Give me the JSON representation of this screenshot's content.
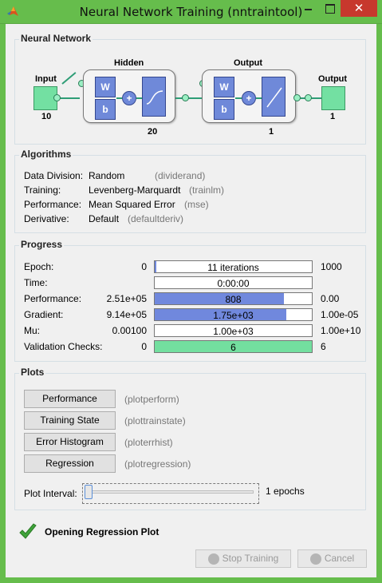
{
  "window": {
    "title": "Neural Network Training (nntraintool)",
    "close_glyph": "✕"
  },
  "network": {
    "section_title": "Neural Network",
    "input": {
      "label": "Input",
      "size": "10"
    },
    "hidden": {
      "label": "Hidden",
      "size": "20",
      "w_label": "W",
      "b_label": "b",
      "sum_label": "+"
    },
    "output_layer": {
      "label": "Output",
      "size": "1",
      "w_label": "W",
      "b_label": "b",
      "sum_label": "+"
    },
    "output": {
      "label": "Output",
      "size": "1"
    }
  },
  "algorithms": {
    "section_title": "Algorithms",
    "rows": [
      {
        "label": "Data Division:",
        "value": "Random",
        "func": "(dividerand)"
      },
      {
        "label": "Training:",
        "value": "Levenberg-Marquardt",
        "func": "(trainlm)"
      },
      {
        "label": "Performance:",
        "value": "Mean Squared Error",
        "func": "(mse)"
      },
      {
        "label": "Derivative:",
        "value": "Default",
        "func": "(defaultderiv)"
      }
    ]
  },
  "progress": {
    "section_title": "Progress",
    "rows": [
      {
        "label": "Epoch:",
        "start": "0",
        "current": "11 iterations",
        "end": "1000",
        "fill_fraction": 0.011,
        "fill_color": "#7088dd"
      },
      {
        "label": "Time:",
        "start": "",
        "current": "0:00:00",
        "end": "",
        "fill_fraction": 0,
        "fill_color": "#7088dd"
      },
      {
        "label": "Performance:",
        "start": "2.51e+05",
        "current": "808",
        "end": "0.00",
        "fill_fraction": 0.82,
        "fill_color": "#7088dd"
      },
      {
        "label": "Gradient:",
        "start": "9.14e+05",
        "current": "1.75e+03",
        "end": "1.00e-05",
        "fill_fraction": 0.84,
        "fill_color": "#7088dd"
      },
      {
        "label": "Mu:",
        "start": "0.00100",
        "current": "1.00e+03",
        "end": "1.00e+10",
        "fill_fraction": 0,
        "fill_color": "#7088dd"
      },
      {
        "label": "Validation Checks:",
        "start": "0",
        "current": "6",
        "end": "6",
        "fill_fraction": 1.0,
        "fill_color": "#73df9f"
      }
    ]
  },
  "plots": {
    "section_title": "Plots",
    "buttons": [
      {
        "label": "Performance",
        "func": "(plotperform)"
      },
      {
        "label": "Training State",
        "func": "(plottrainstate)"
      },
      {
        "label": "Error Histogram",
        "func": "(ploterrhist)"
      },
      {
        "label": "Regression",
        "func": "(plotregression)"
      }
    ],
    "interval_label": "Plot Interval:",
    "interval_value": "1 epochs",
    "interval_slider_fraction": 0
  },
  "status": {
    "icon": "checkmark-icon",
    "text": "Opening Regression Plot"
  },
  "footer": {
    "stop_label": "Stop Training",
    "cancel_label": "Cancel"
  }
}
